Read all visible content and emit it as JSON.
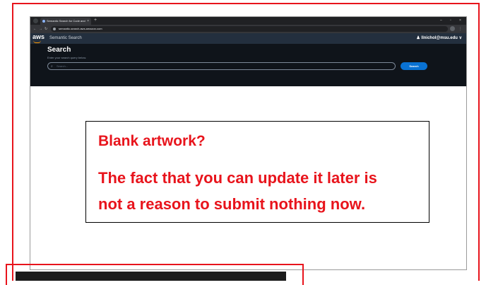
{
  "browser": {
    "tab_title": "Semantic Search for Code and",
    "new_tab": "+",
    "tab_close": "×",
    "url": "semantic-search.aws.amazon.com"
  },
  "aws_header": {
    "logo": "aws",
    "app_name": "Semantic Search",
    "user": "llnichol@msu.edu ∨"
  },
  "search": {
    "title": "Search",
    "subtitle": "Enter your search query below.",
    "placeholder": "Search...",
    "button": "Search"
  },
  "message": {
    "title": "Blank artwork?",
    "line1": "The fact that you can update it later is",
    "line2": "not a reason to submit nothing now."
  },
  "colors": {
    "frame_red": "#e8141c",
    "aws_header": "#232f3e",
    "search_band": "#0f141a",
    "search_button": "#0972d3"
  }
}
